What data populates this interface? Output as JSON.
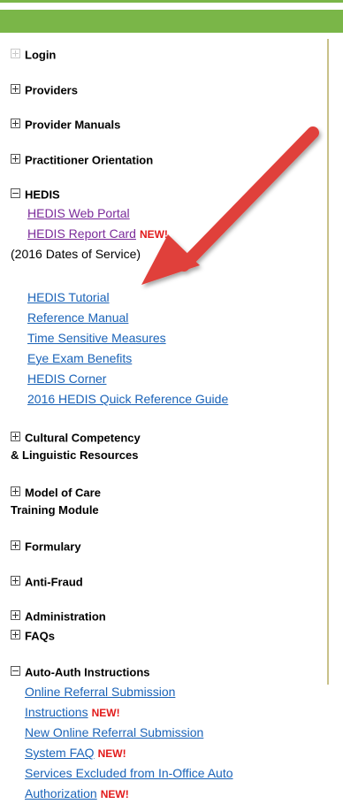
{
  "nav": {
    "login": "Login",
    "providers": "Providers",
    "provider_manuals": "Provider Manuals",
    "practitioner_orientation": "Practitioner Orientation",
    "hedis": {
      "label": "HEDIS",
      "web_portal": "HEDIS Web Portal",
      "report_card": "HEDIS Report Card",
      "dates_note": "(2016 Dates of Service)",
      "tutorial": "HEDIS Tutorial",
      "reference_manual": "Reference Manual",
      "time_sensitive": "Time Sensitive Measures",
      "eye_exam": "Eye Exam Benefits",
      "corner": "HEDIS Corner",
      "quick_ref": "2016 HEDIS Quick Reference Guide"
    },
    "cultural_line1": "Cultural Competency",
    "cultural_line2": "& Linguistic Resources",
    "model_line1": "Model of Care",
    "model_line2": "Training Module",
    "formulary": "Formulary",
    "anti_fraud": "Anti-Fraud",
    "administration": "Administration",
    "faqs": "FAQs",
    "auto_auth": {
      "label": "Auto-Auth Instructions",
      "online_referral": "Online Referral Submission",
      "instructions": "Instructions",
      "new_online_referral": "New Online Referral Submission",
      "system_faq": "System FAQ",
      "services_excluded_line1": "Services Excluded from In-Office Auto",
      "services_excluded_line2": "Authorization"
    },
    "new_badge": "NEW!"
  },
  "colors": {
    "brand_green": "#7ab648",
    "link_blue": "#1a63b8",
    "visited_purple": "#7a2a9a",
    "new_red": "#e21b1b",
    "arrow_red": "#e0403a"
  },
  "icons": {
    "expanded": "minus-box-icon",
    "collapsed": "plus-box-icon"
  }
}
